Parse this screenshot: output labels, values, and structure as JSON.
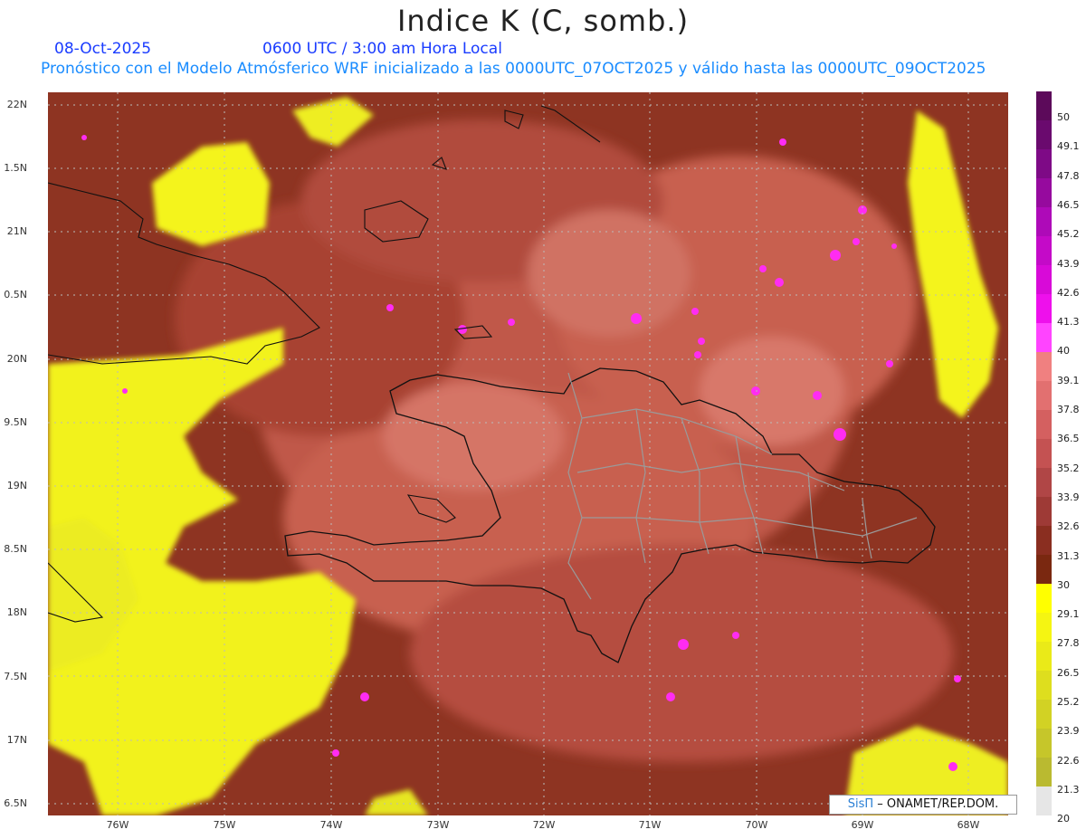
{
  "title": "Indice K (C, somb.)",
  "date": "08-Oct-2025",
  "time": "0600 UTC / 3:00 am Hora Local",
  "subtitle": "Pronóstico con el Modelo Atmósferico WRF inicializado a las 0000UTC_07OCT2025 y válido hasta las  0000UTC_09OCT2025",
  "lat_labels": [
    "22N",
    "1.5N",
    "21N",
    "0.5N",
    "20N",
    "9.5N",
    "19N",
    "8.5N",
    "18N",
    "7.5N",
    "17N",
    "6.5N"
  ],
  "lon_labels": [
    "76W",
    "75W",
    "74W",
    "73W",
    "72W",
    "71W",
    "70W",
    "69W",
    "68W"
  ],
  "colorbar": {
    "labels": [
      "50",
      "49.1",
      "47.8",
      "46.5",
      "45.2",
      "43.9",
      "42.6",
      "41.3",
      "40",
      "39.1",
      "37.8",
      "36.5",
      "35.2",
      "33.9",
      "32.6",
      "31.3",
      "30",
      "29.1",
      "27.8",
      "26.5",
      "25.2",
      "23.9",
      "22.6",
      "21.3",
      "20"
    ],
    "colors": [
      "#5c0a5a",
      "#6a0a6e",
      "#7e0a86",
      "#960a9e",
      "#ae0ab8",
      "#c40ac8",
      "#d80ad8",
      "#ee10ec",
      "#ff44ff",
      "#f08080",
      "#e27070",
      "#d46060",
      "#c45252",
      "#b04646",
      "#9e3a36",
      "#8a2e20",
      "#7a2810",
      "#ffff00",
      "#f5f512",
      "#eaea18",
      "#dede1e",
      "#d2d224",
      "#c6c62a",
      "#baba30",
      "#e6e6e6"
    ]
  },
  "credit": {
    "logo": "SisΠ",
    "text": "– ONAMET/REP.DOM."
  }
}
